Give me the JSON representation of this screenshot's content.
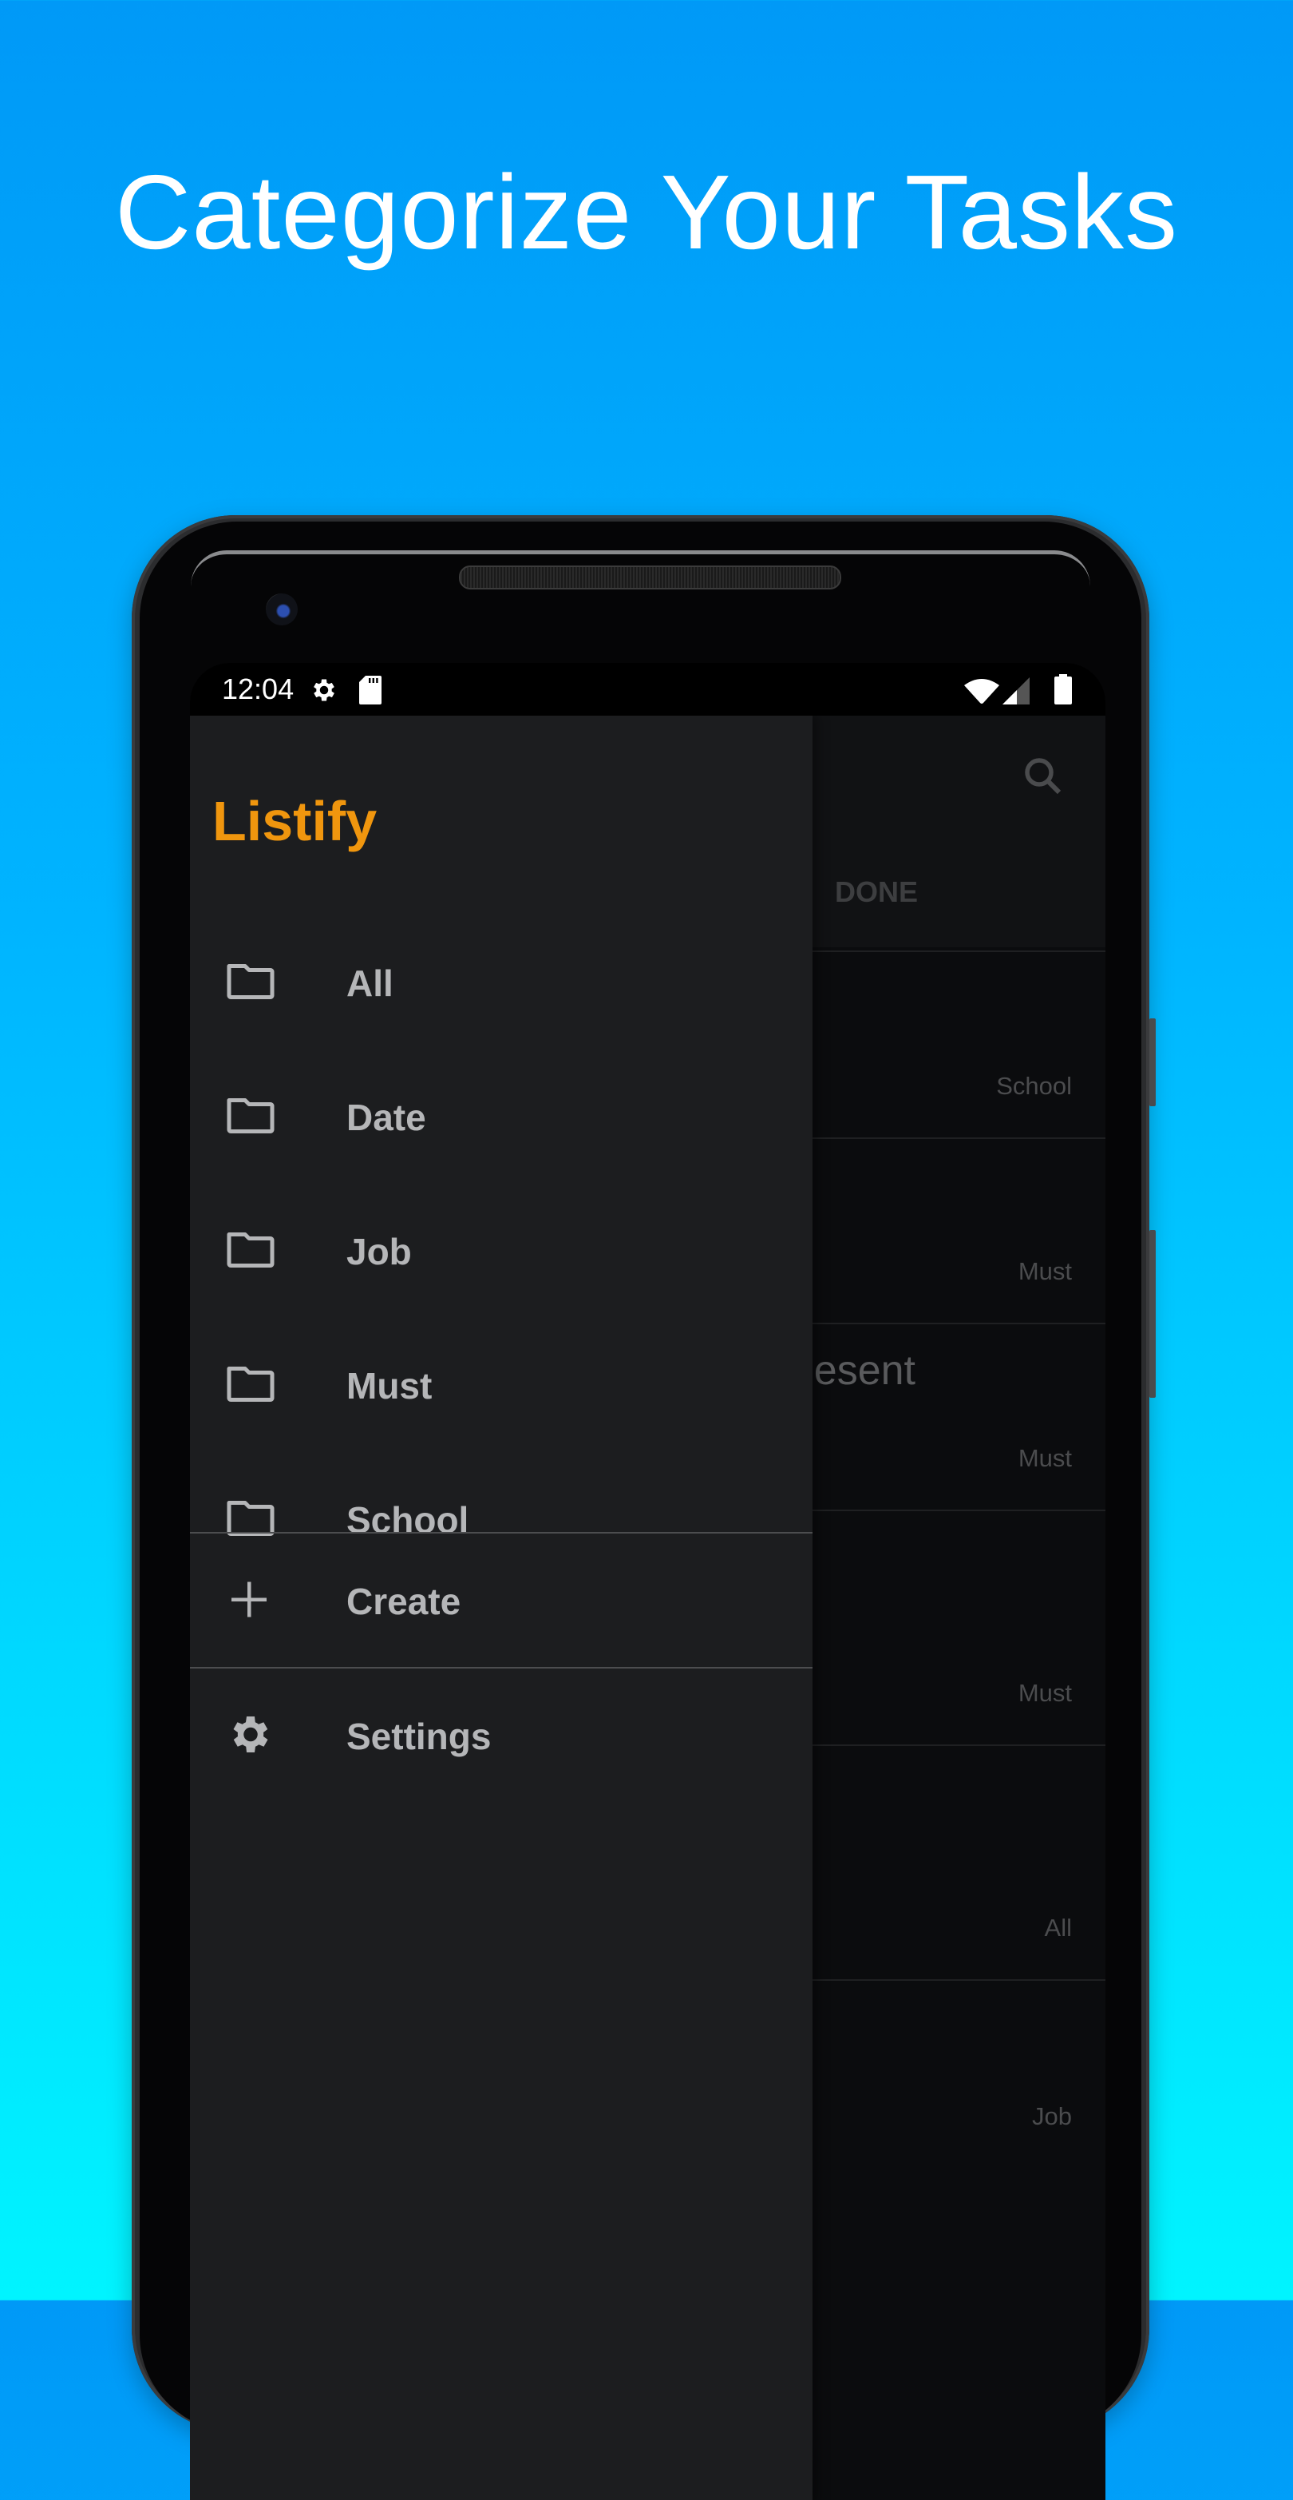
{
  "headline": "Categorize Your Tasks",
  "colors": {
    "accent": "#f0960e",
    "drawer_bg": "#1c1d1f",
    "menu_text": "#b5b6b8",
    "background_top": "#0099f7",
    "background_bottom": "#00f4ff"
  },
  "status_bar": {
    "time": "12:04",
    "left_icons": [
      "settings-gear-icon",
      "sd-card-icon"
    ],
    "right_icons": [
      "wifi-icon",
      "cellular-signal-icon",
      "battery-icon"
    ]
  },
  "drawer": {
    "app_title": "Listify",
    "categories": [
      {
        "label": "All",
        "icon": "folder-icon"
      },
      {
        "label": "Date",
        "icon": "folder-icon"
      },
      {
        "label": "Job",
        "icon": "folder-icon"
      },
      {
        "label": "Must",
        "icon": "folder-icon"
      },
      {
        "label": "School",
        "icon": "folder-icon"
      }
    ],
    "create": {
      "label": "Create",
      "icon": "plus-icon"
    },
    "settings": {
      "label": "Settings",
      "icon": "gear-icon"
    }
  },
  "background_screen": {
    "toolbar": {
      "search_icon": "search-icon",
      "visible_tab": "DONE"
    },
    "tasks": [
      {
        "title": "",
        "tag": "School"
      },
      {
        "title": "",
        "tag": "Must"
      },
      {
        "title": "esent",
        "tag": "Must"
      },
      {
        "title": "",
        "tag": "Must"
      },
      {
        "title": "",
        "tag": "All"
      },
      {
        "title": "",
        "tag": "Job"
      }
    ]
  }
}
